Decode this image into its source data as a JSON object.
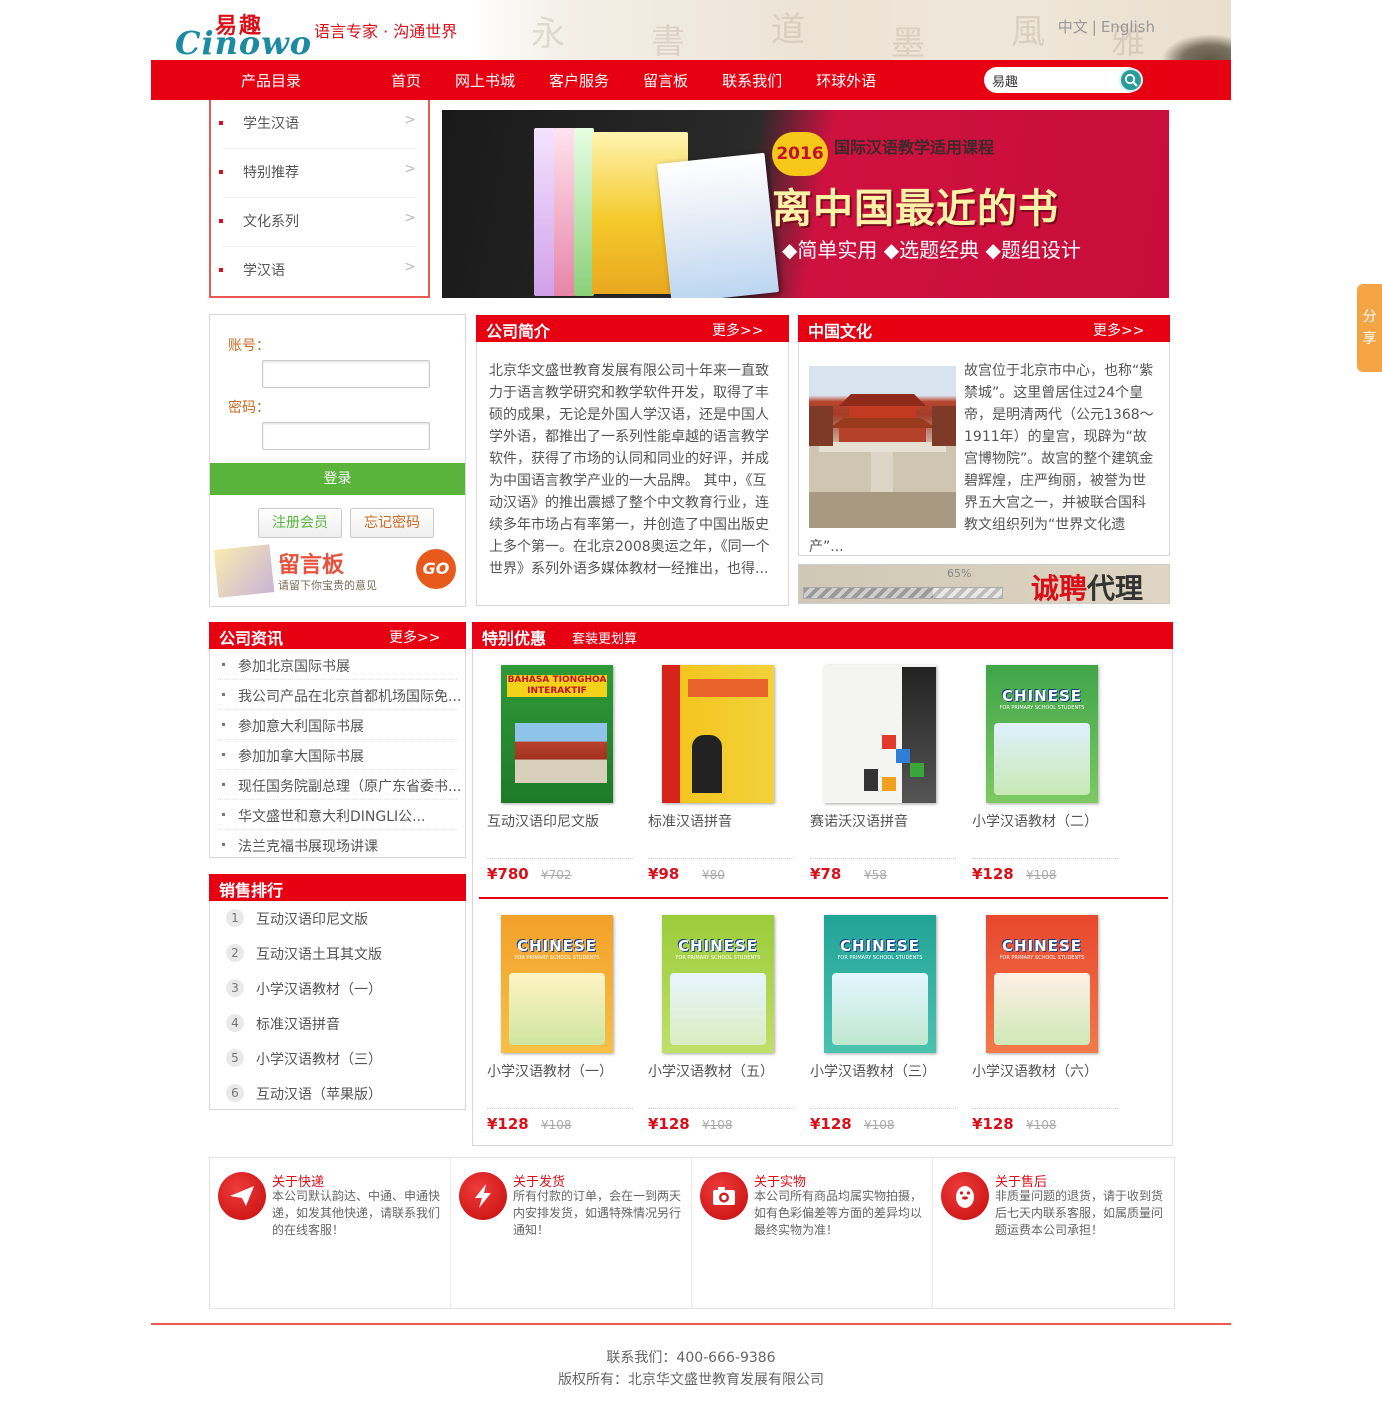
{
  "header": {
    "logo_cn": "易趣",
    "logo_en": "Cinowo",
    "slogan": "语言专家 · 沟通世界",
    "lang_cn": "中文",
    "lang_sep": "|",
    "lang_en": "English"
  },
  "nav": {
    "catalog": "产品目录",
    "items": [
      "首页",
      "网上书城",
      "客户服务",
      "留言板",
      "联系我们",
      "环球外语"
    ],
    "search_value": "易趣"
  },
  "categories": [
    "学生汉语",
    "特别推荐",
    "文化系列",
    "学汉语"
  ],
  "banner": {
    "year": "2016",
    "subtitle": "国际汉语教学适用课程",
    "headline": "离中国最近的书",
    "tags": "◆简单实用 ◆选题经典 ◆题组设计"
  },
  "login": {
    "account_label": "账号：",
    "password_label": "密码：",
    "login_button": "登录",
    "register_button": "注册会员",
    "forgot_button": "忘记密码",
    "board_title": "留言板",
    "board_sub": "请留下你宝贵的意见",
    "board_go": "GO"
  },
  "intro": {
    "title": "公司简介",
    "more": "更多>>",
    "text": "北京华文盛世教育发展有限公司十年来一直致力于语言教学研究和教学软件开发，取得了丰硕的成果，无论是外国人学汉语，还是中国人学外语，都推出了一系列性能卓越的语言教学软件，获得了市场的认同和同业的好评，并成为中国语言教学产业的一大品牌。 其中，《互动汉语》的推出震撼了整个中文教育行业，连续多年市场占有率第一，并创造了中国出版史上多个第一。在北京2008奥运之年，《同一个世界》系列外语多媒体教材一经推出，也得..."
  },
  "culture": {
    "title": "中国文化",
    "more": "更多>>",
    "text": "故宫位于北京市中心，也称“紫禁城”。这里曾居住过24个皇帝，是明清两代（公元1368～1911年）的皇宫，现辟为“故宫博物院”。故宫的整个建筑金碧辉煌，庄严绚丽，被誉为世界五大宫之一，并被联合国科教文组织列为“世界文化遗产”..."
  },
  "recruit": {
    "progress": 0.65,
    "progress_label": "65%",
    "text_red": "诚聘",
    "text_black": "代理商"
  },
  "news": {
    "title": "公司资讯",
    "more": "更多>>",
    "items": [
      "参加北京国际书展",
      "我公司产品在北京首都机场国际免...",
      "参加意大利国际书展",
      "参加加拿大国际书展",
      "现任国务院副总理（原广东省委书...",
      "华文盛世和意大利DINGLI公...",
      "法兰克福书展现场讲课"
    ]
  },
  "ranking": {
    "title": "销售排行",
    "items": [
      {
        "num": "1",
        "name": "互动汉语印尼文版"
      },
      {
        "num": "2",
        "name": "互动汉语土耳其文版"
      },
      {
        "num": "3",
        "name": "小学汉语教材（一）"
      },
      {
        "num": "4",
        "name": "标准汉语拼音"
      },
      {
        "num": "5",
        "name": "小学汉语教材（三）"
      },
      {
        "num": "6",
        "name": "互动汉语（苹果版）"
      }
    ]
  },
  "special": {
    "title": "特别优惠",
    "subtitle": "套装更划算",
    "products": [
      {
        "name": "互动汉语印尼文版",
        "price": "¥780",
        "old": "¥702",
        "cover": "indo"
      },
      {
        "name": "标准汉语拼音",
        "price": "¥98",
        "old": "¥80",
        "cover": "pinyin"
      },
      {
        "name": "赛诺沃汉语拼音",
        "price": "¥78",
        "old": "¥58",
        "cover": "alphabet"
      },
      {
        "name": "小学汉语教材（二）",
        "price": "¥128",
        "old": "¥108",
        "cover": "green"
      },
      {
        "name": "小学汉语教材（一）",
        "price": "¥128",
        "old": "¥108",
        "cover": "orange"
      },
      {
        "name": "小学汉语教材（五）",
        "price": "¥128",
        "old": "¥108",
        "cover": "lime"
      },
      {
        "name": "小学汉语教材（三）",
        "price": "¥128",
        "old": "¥108",
        "cover": "teal"
      },
      {
        "name": "小学汉语教材（六）",
        "price": "¥128",
        "old": "¥108",
        "cover": "red"
      }
    ],
    "cover_brand": "CHINESE",
    "cover_small": "FOR PRIMARY SCHOOL STUDENTS"
  },
  "services": [
    {
      "title": "关于快递",
      "desc": "本公司默认韵达、中通、申通快递，如发其他快递，请联系我们的在线客服！",
      "icon": "paper-plane-icon"
    },
    {
      "title": "关于发货",
      "desc": "所有付款的订单，会在一到两天内安排发货，如遇特殊情况另行通知！",
      "icon": "lightning-icon"
    },
    {
      "title": "关于实物",
      "desc": "本公司所有商品均属实物拍摄，如有色彩偏差等方面的差异均以最终实物为准！",
      "icon": "camera-icon"
    },
    {
      "title": "关于售后",
      "desc": "非质量问题的退货，请于收到货后七天内联系客服，如属质量问题运费本公司承担！",
      "icon": "penguin-icon"
    }
  ],
  "footer": {
    "contact": "联系我们：400-666-9386",
    "copyright": "版权所有：北京华文盛世教育发展有限公司"
  },
  "share": {
    "label": "分享"
  },
  "colors": {
    "brand_red": "#e60012",
    "green": "#5ab43c",
    "accent_orange": "#f5a445"
  }
}
